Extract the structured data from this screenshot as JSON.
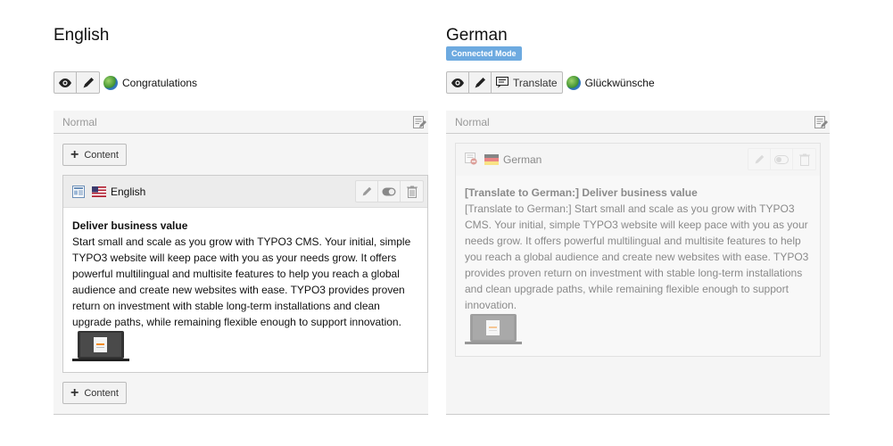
{
  "english": {
    "title": "English",
    "page_title": "Congratulations",
    "column_label": "Normal",
    "add_content_label": "Content",
    "element": {
      "language": "English",
      "header": "Deliver business value",
      "bodytext": "Start small and scale as you grow with TYPO3 CMS. Your initial, simple TYPO3 website will keep pace with you as your needs grow. It offers powerful multilingual and multisite features to help you reach a global audience and create new websites with ease. TYPO3 provides proven return on investment with stable long-term installations and clean upgrade paths, while remaining flexible enough to support innovation."
    }
  },
  "german": {
    "title": "German",
    "badge": "Connected Mode",
    "translate_label": "Translate",
    "page_title": "Glückwünsche",
    "column_label": "Normal",
    "element": {
      "language": "German",
      "header": "[Translate to German:] Deliver business value",
      "bodytext": "[Translate to German:] Start small and scale as you grow with TYPO3 CMS. Your initial, simple TYPO3 website will keep pace with you as your needs grow. It offers powerful multilingual and multisite features to help you reach a global audience and create new websites with ease. TYPO3 provides proven return on investment with stable long-term installations and clean upgrade paths, while remaining flexible enough to support innovation."
    }
  },
  "icons": [
    "eye-icon",
    "pencil-icon",
    "globe-icon",
    "translate-icon",
    "edit-column-icon",
    "content-element-icon",
    "us-flag-icon",
    "german-flag-icon",
    "toggle-icon",
    "trash-icon",
    "plus-icon",
    "laptop-image"
  ],
  "colors": {
    "badge": "#6daae0",
    "column_bg": "#f5f5f5",
    "element_head": "#ececec"
  }
}
